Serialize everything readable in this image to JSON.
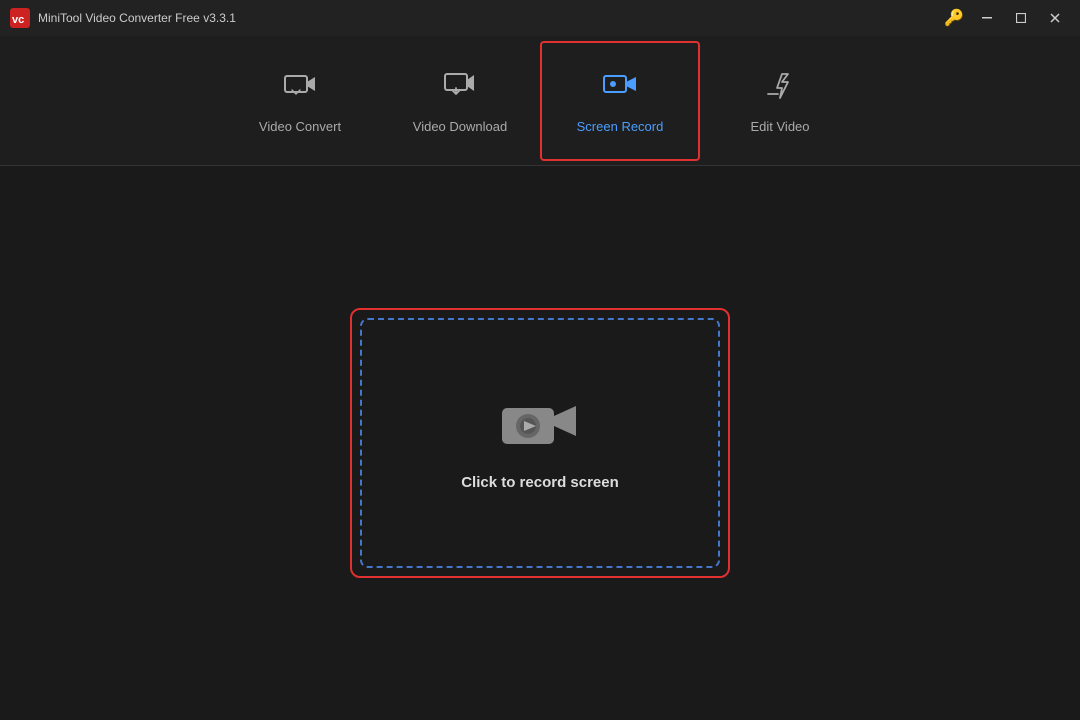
{
  "titleBar": {
    "title": "MiniTool Video Converter Free v3.3.1",
    "controls": {
      "minimize": "—",
      "maximize": "□",
      "close": "✕"
    }
  },
  "nav": {
    "tabs": [
      {
        "id": "video-convert",
        "label": "Video Convert",
        "active": false
      },
      {
        "id": "video-download",
        "label": "Video Download",
        "active": false
      },
      {
        "id": "screen-record",
        "label": "Screen Record",
        "active": true
      },
      {
        "id": "edit-video",
        "label": "Edit Video",
        "active": false
      }
    ]
  },
  "main": {
    "recordArea": {
      "prompt": "Click to record screen"
    }
  }
}
